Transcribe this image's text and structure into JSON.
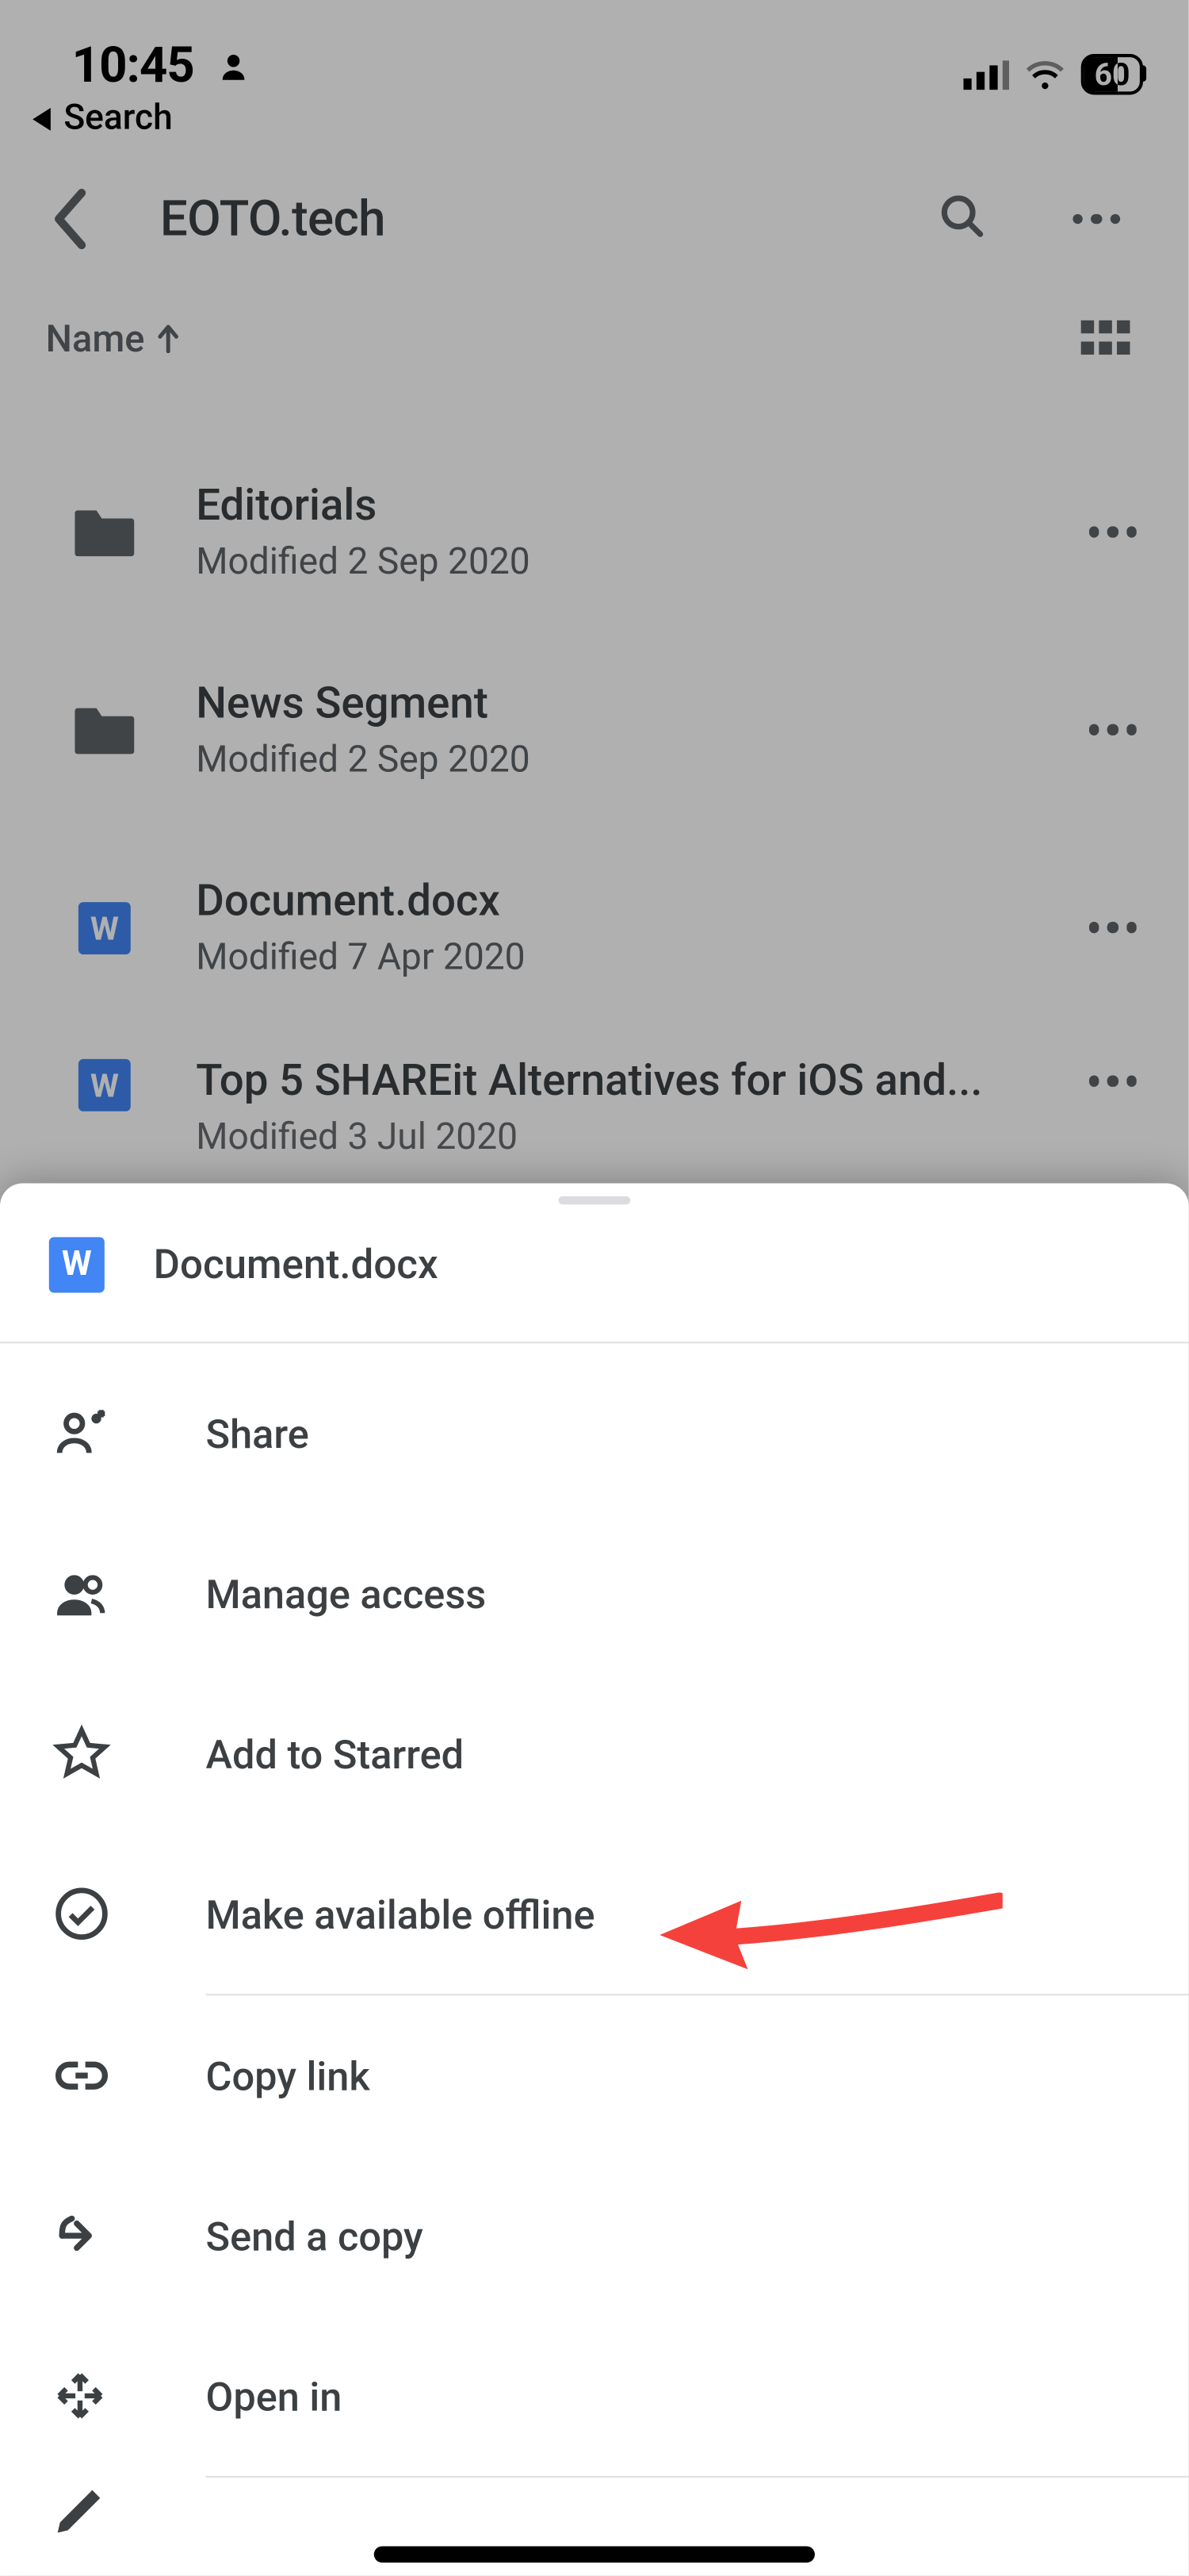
{
  "status": {
    "time": "10:45",
    "battery_percent": "60",
    "back_label": "Search"
  },
  "header": {
    "title": "EOTO.tech"
  },
  "sort": {
    "label": "Name"
  },
  "files": [
    {
      "name": "Editorials",
      "modified": "Modified 2 Sep 2020",
      "icon": "folder"
    },
    {
      "name": "News Segment",
      "modified": "Modified 2 Sep 2020",
      "icon": "folder"
    },
    {
      "name": "Document.docx",
      "modified": "Modified 7 Apr 2020",
      "icon": "word"
    },
    {
      "name": "Top 5 SHAREit Alternatives for iOS and...",
      "modified": "Modified 3 Jul 2020",
      "icon": "word"
    }
  ],
  "sheet": {
    "filename": "Document.docx",
    "actions": {
      "share": "Share",
      "manage": "Manage access",
      "starred": "Add to Starred",
      "offline": "Make available offline",
      "copylink": "Copy link",
      "sendcopy": "Send a copy",
      "openin": "Open in"
    }
  },
  "icons": {
    "word_letter": "W"
  }
}
